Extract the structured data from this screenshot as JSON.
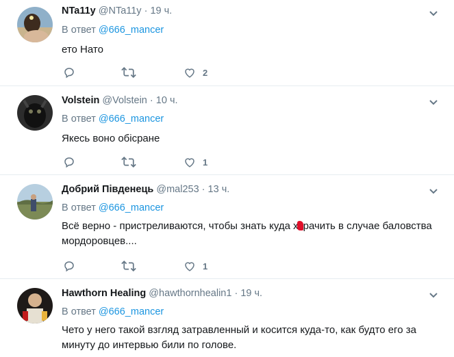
{
  "reply_prefix": "В ответ",
  "tweets": [
    {
      "name": "NTa11y",
      "handle": "@NTa11y",
      "time": "19 ч.",
      "reply_to": "@666_mancer",
      "lines": [
        "ето Нато"
      ],
      "likes": "2",
      "avatar_colors": [
        "#6d8fa9",
        "#b89571"
      ]
    },
    {
      "name": "Volstein",
      "handle": "@Volstein",
      "time": "10 ч.",
      "reply_to": "@666_mancer",
      "lines": [
        "Якесь воно обісране"
      ],
      "likes": "1",
      "avatar_colors": [
        "#2a2a2a",
        "#4a4a4a"
      ]
    },
    {
      "name": "Добрий Південець",
      "handle": "@mal253",
      "time": "13 ч.",
      "reply_to": "@666_mancer",
      "lines": [
        "Всё верно - пристреливаются, чтобы знать куда х",
        "рачить в случае баловства",
        "мордоровцев...."
      ],
      "likes": "1",
      "avatar_colors": [
        "#a9c4d9",
        "#6f7e50"
      ]
    },
    {
      "name": "Hawthorn Healing",
      "handle": "@hawthornhealin1",
      "time": "19 ч.",
      "reply_to": "@666_mancer",
      "lines": [
        "Чето у него такой взгляд затравленный и косится куда-то, как будто его за",
        "минуту до интервью били по голове."
      ],
      "likes": "",
      "avatar_colors": [
        "#3b2a22",
        "#d9c8a4"
      ]
    }
  ],
  "colors": {
    "accent": "#1b95e0",
    "muted": "#657786",
    "divider": "#e6ecf0",
    "redaction": "#e0102a"
  },
  "icons": [
    "reply-icon",
    "retweet-icon",
    "like-icon",
    "chevron-down-icon"
  ]
}
